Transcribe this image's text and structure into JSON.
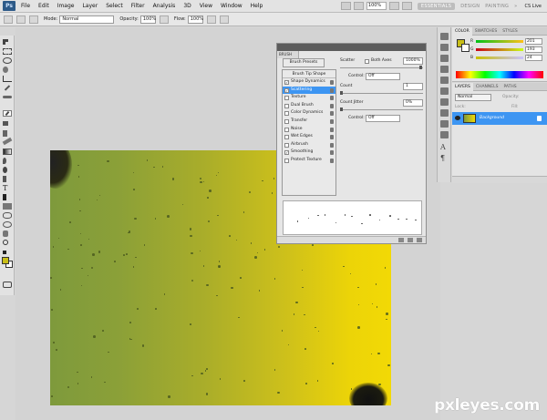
{
  "menubar": {
    "app_icon": "Ps",
    "items": [
      "File",
      "Edit",
      "Image",
      "Layer",
      "Select",
      "Filter",
      "Analysis",
      "3D",
      "View",
      "Window",
      "Help"
    ],
    "zoom": "100%",
    "workspaces": [
      "ESSENTIALS",
      "DESIGN",
      "PAINTING"
    ],
    "more": "»",
    "cs_live": "CS Live"
  },
  "options_bar": {
    "mode_label": "Mode:",
    "mode_value": "Normal",
    "opacity_label": "Opacity:",
    "opacity_value": "100%",
    "flow_label": "Flow:",
    "flow_value": "100%"
  },
  "brush_panel": {
    "tab": "BRUSH",
    "presets_button": "Brush Presets",
    "tip_header": "Brush Tip Shape",
    "tip_items": [
      {
        "label": "Shape Dynamics",
        "checked": true,
        "selected": false
      },
      {
        "label": "Scattering",
        "checked": true,
        "selected": true
      },
      {
        "label": "Texture",
        "checked": false,
        "selected": false
      },
      {
        "label": "Dual Brush",
        "checked": false,
        "selected": false
      },
      {
        "label": "Color Dynamics",
        "checked": false,
        "selected": false
      },
      {
        "label": "Transfer",
        "checked": false,
        "selected": false
      },
      {
        "label": "Noise",
        "checked": false,
        "selected": false
      },
      {
        "label": "Wet Edges",
        "checked": false,
        "selected": false
      },
      {
        "label": "Airbrush",
        "checked": false,
        "selected": false
      },
      {
        "label": "Smoothing",
        "checked": true,
        "selected": false
      },
      {
        "label": "Protect Texture",
        "checked": false,
        "selected": false
      }
    ],
    "scatter_label": "Scatter",
    "both_axes_label": "Both Axes",
    "scatter_value": "1000%",
    "control_label_1": "Control:",
    "control_value_1": "Off",
    "count_label": "Count",
    "count_value": "1",
    "count_jitter_label": "Count Jitter",
    "count_jitter_value": "0%",
    "control_label_2": "Control:",
    "control_value_2": "Off"
  },
  "color_panel": {
    "tabs": [
      "COLOR",
      "SWATCHES",
      "STYLES"
    ],
    "fg_color": "#c9bf18",
    "bg_color": "#ffffff",
    "r_label": "R",
    "g_label": "G",
    "b_label": "B",
    "r_value": "201",
    "g_value": "193",
    "b_value": "24"
  },
  "layers_panel": {
    "tabs": [
      "LAYERS",
      "CHANNELS",
      "PATHS"
    ],
    "blend_mode": "Normal",
    "opacity_label": "Opacity:",
    "lock_label": "Lock:",
    "fill_label": "Fill:",
    "layer_name": "Background"
  },
  "watermark": "pxleyes.com"
}
